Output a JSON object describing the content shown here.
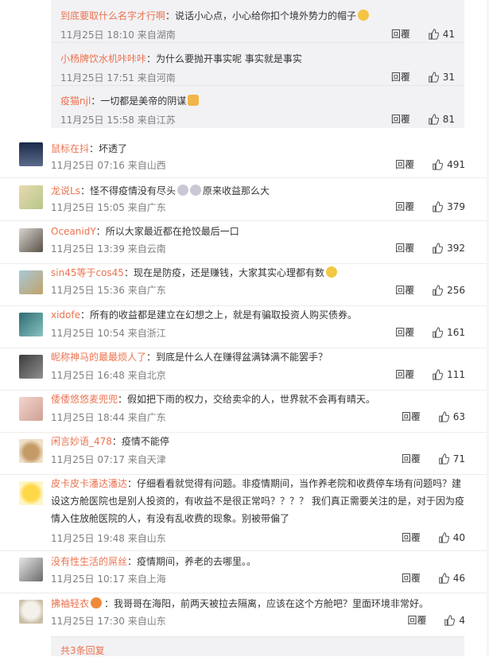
{
  "replies": [
    {
      "user": "到底要取什么名字才行啊",
      "text": "说话小心点，小心给你扣个境外势力的帽子",
      "emoji": "cat-face",
      "time": "11月25日 18:10 来自湖南",
      "reply_label": "回覆",
      "likes": "41"
    },
    {
      "user": "小杨牌饮水机咔咔咔",
      "text": "为什么要抛开事实呢 事实就是事实",
      "emoji": "",
      "time": "11月25日 17:51 来自河南",
      "reply_label": "回覆",
      "likes": "31"
    },
    {
      "user": "疫猫njl",
      "text": "一切都是美帝的阴谋",
      "emoji": "thumbs-up",
      "time": "11月25日 15:58 来自江苏",
      "reply_label": "回覆",
      "likes": "81"
    }
  ],
  "comments": [
    {
      "user": "鼠标在抖",
      "text": "坏透了",
      "time": "11月25日 07:16 来自山西",
      "reply_label": "回覆",
      "likes": "491"
    },
    {
      "user": "龙说Ls",
      "text": "怪不得疫情没有尽头",
      "text2": "原来收益那么大",
      "time": "11月25日 15:05 来自广东",
      "reply_label": "回覆",
      "likes": "379"
    },
    {
      "user": "OceanidY",
      "text": "所以大家最近都在抢饺最后一口",
      "time": "11月25日 13:39 来自云南",
      "reply_label": "回覆",
      "likes": "392"
    },
    {
      "user": "sin45等于cos45",
      "text": "现在是防疫，还是赚钱，大家其实心理都有数",
      "time": "11月25日 15:36 来自广东",
      "reply_label": "回覆",
      "likes": "256"
    },
    {
      "user": "xidofe",
      "text": "所有的收益都是建立在幻想之上，就是有骗取投资人购买债券。",
      "time": "11月25日 10:54 来自浙江",
      "reply_label": "回覆",
      "likes": "161"
    },
    {
      "user": "昵称神马的最最烦人了",
      "text": "到底是什么人在赚得盆满钵满不能罢手？",
      "time": "11月25日 16:48 来自北京",
      "reply_label": "回覆",
      "likes": "111"
    },
    {
      "user": "倭倭悠悠麦兜兜",
      "text": "假如把下雨的权力，交给卖伞的人，世界就不会再有晴天。",
      "time": "11月25日 18:44 来自广东",
      "reply_label": "回覆",
      "likes": "63"
    },
    {
      "user": "闲言妙语_478",
      "text": "疫情不能停",
      "time": "11月25日 07:17 来自天津",
      "reply_label": "回覆",
      "likes": "71"
    },
    {
      "user": "皮卡皮卡潘达潘达",
      "text": "仔细看看就觉得有问题。非疫情期间，当作养老院和收费停车场有问题吗？建设这方舱医院也是别人投资的，有收益不是很正常吗？？？？ 我们真正需要关注的是，对于因为疫情入住放舱医院的人，有没有乱收费的现象。别被带偏了",
      "time": "11月25日 19:48 来自山东",
      "reply_label": "回覆",
      "likes": "40"
    },
    {
      "user": "没有性生活的屌丝",
      "text": "疫情期间，养老的去哪里。。",
      "time": "11月25日 10:17 来自上海",
      "reply_label": "回覆",
      "likes": "46"
    },
    {
      "user": "拂袖轻衣",
      "text": "我哥哥在海阳，前两天被拉去隔离，应该在这个方舱吧？里面环境非常好。",
      "time": "11月25日 17:30 来自山东",
      "reply_label": "回覆",
      "likes": "4"
    }
  ],
  "more_replies": "共3条回复",
  "colors": {
    "username": "#eb7350",
    "meta": "#808080",
    "panel": "#f2f2f5"
  }
}
